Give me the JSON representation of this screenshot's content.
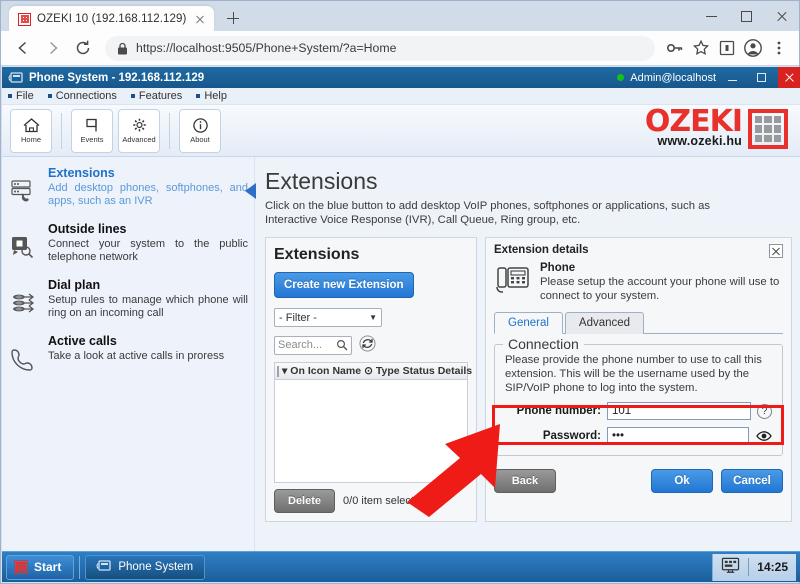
{
  "browser": {
    "tab": {
      "title": "OZEKI 10 (192.168.112.129)",
      "favicon": "ozeki-grid-icon",
      "close": "close-icon"
    },
    "new_tab": "+",
    "nav": {
      "back": "back-arrow-icon",
      "forward": "forward-arrow-icon",
      "reload": "reload-icon"
    },
    "omnibox": {
      "lock": "lock-icon",
      "url_scheme": "https://",
      "url_host": "localhost:9505",
      "url_path": "/Phone+System/?a=Home",
      "full_url": "https://localhost:9505/Phone+System/?a=Home"
    },
    "actions": [
      "key-icon",
      "star-icon",
      "extension-icon",
      "profile-avatar-icon",
      "more-menu-icon"
    ],
    "window_controls": {
      "minimize": "minimize-icon",
      "maximize": "maximize-icon",
      "close": "close-icon"
    }
  },
  "app": {
    "title": "Phone System - 192.168.112.129",
    "title_icon": "phone-system-icon",
    "user": "Admin@localhost",
    "status_dot_color": "#14c414",
    "window_controls": {
      "minimize": "minimize-icon",
      "maximize": "maximize-icon",
      "close": "close-icon"
    },
    "menus": [
      "File",
      "Connections",
      "Features",
      "Help"
    ],
    "toolbar": [
      {
        "label": "Home",
        "icon": "home-icon"
      },
      {
        "label": "Events",
        "icon": "flag-icon"
      },
      {
        "label": "Advanced",
        "icon": "gear-icon"
      },
      {
        "label": "About",
        "icon": "info-icon"
      }
    ],
    "logo": {
      "wordmark": "OZEKI",
      "sub": "www.ozeki.hu",
      "color": "#e8312a"
    }
  },
  "sidebar": {
    "items": [
      {
        "title": "Extensions",
        "desc": "Add desktop phones, softphones, and apps, such as an IVR",
        "icon": "pbx-extensions-icon",
        "active": true
      },
      {
        "title": "Outside lines",
        "desc": "Connect your system to the public telephone network",
        "icon": "outside-line-icon",
        "active": false
      },
      {
        "title": "Dial plan",
        "desc": "Setup rules to manage which phone will ring on an incoming call",
        "icon": "dial-plan-icon",
        "active": false
      },
      {
        "title": "Active calls",
        "desc": "Take a look at active calls in proress",
        "icon": "handset-icon",
        "active": false
      }
    ]
  },
  "page": {
    "title": "Extensions",
    "desc": "Click on the blue button to add desktop VoIP phones, softphones or applications, such as Interactive Voice Response (IVR), Call Queue, Ring group, etc."
  },
  "extensions_panel": {
    "heading": "Extensions",
    "create_button": "Create new Extension",
    "filter_value": "- Filter -",
    "search_placeholder": "Search...",
    "search_icon": "magnifier-icon",
    "refresh_icon": "refresh-icon",
    "columns": [
      "On",
      "Icon",
      "Name",
      "Type",
      "Status",
      "Details"
    ],
    "rows": [],
    "delete_button": "Delete",
    "selection_status": "0/0 item selected"
  },
  "details_panel": {
    "title": "Extension details",
    "close_icon": "close-icon",
    "device_icon": "desk-phone-icon",
    "device_name": "Phone",
    "device_desc": "Please setup the account your phone will use to connect to your system.",
    "tabs": [
      {
        "label": "General",
        "selected": true
      },
      {
        "label": "Advanced",
        "selected": false
      }
    ],
    "connection": {
      "legend": "Connection",
      "desc": "Please provide the phone number to use to call this extension. This will be the username used by the SIP/VoIP phone to log into the system.",
      "phone_number_label": "Phone number:",
      "phone_number_value": "101",
      "help_icon": "question-mark-icon",
      "password_label": "Password:",
      "password_value": "•••",
      "reveal_icon": "eye-icon"
    },
    "buttons": {
      "back": "Back",
      "ok": "Ok",
      "cancel": "Cancel"
    }
  },
  "annotation": {
    "highlight_color": "#ee1b16",
    "arrow_icon": "red-arrow-pointing-up-right"
  },
  "taskbar": {
    "start_label": "Start",
    "start_icon": "ozeki-grid-icon",
    "task_label": "Phone System",
    "task_icon": "phone-system-icon",
    "tray_icon": "display-icon",
    "clock": "14:25"
  }
}
